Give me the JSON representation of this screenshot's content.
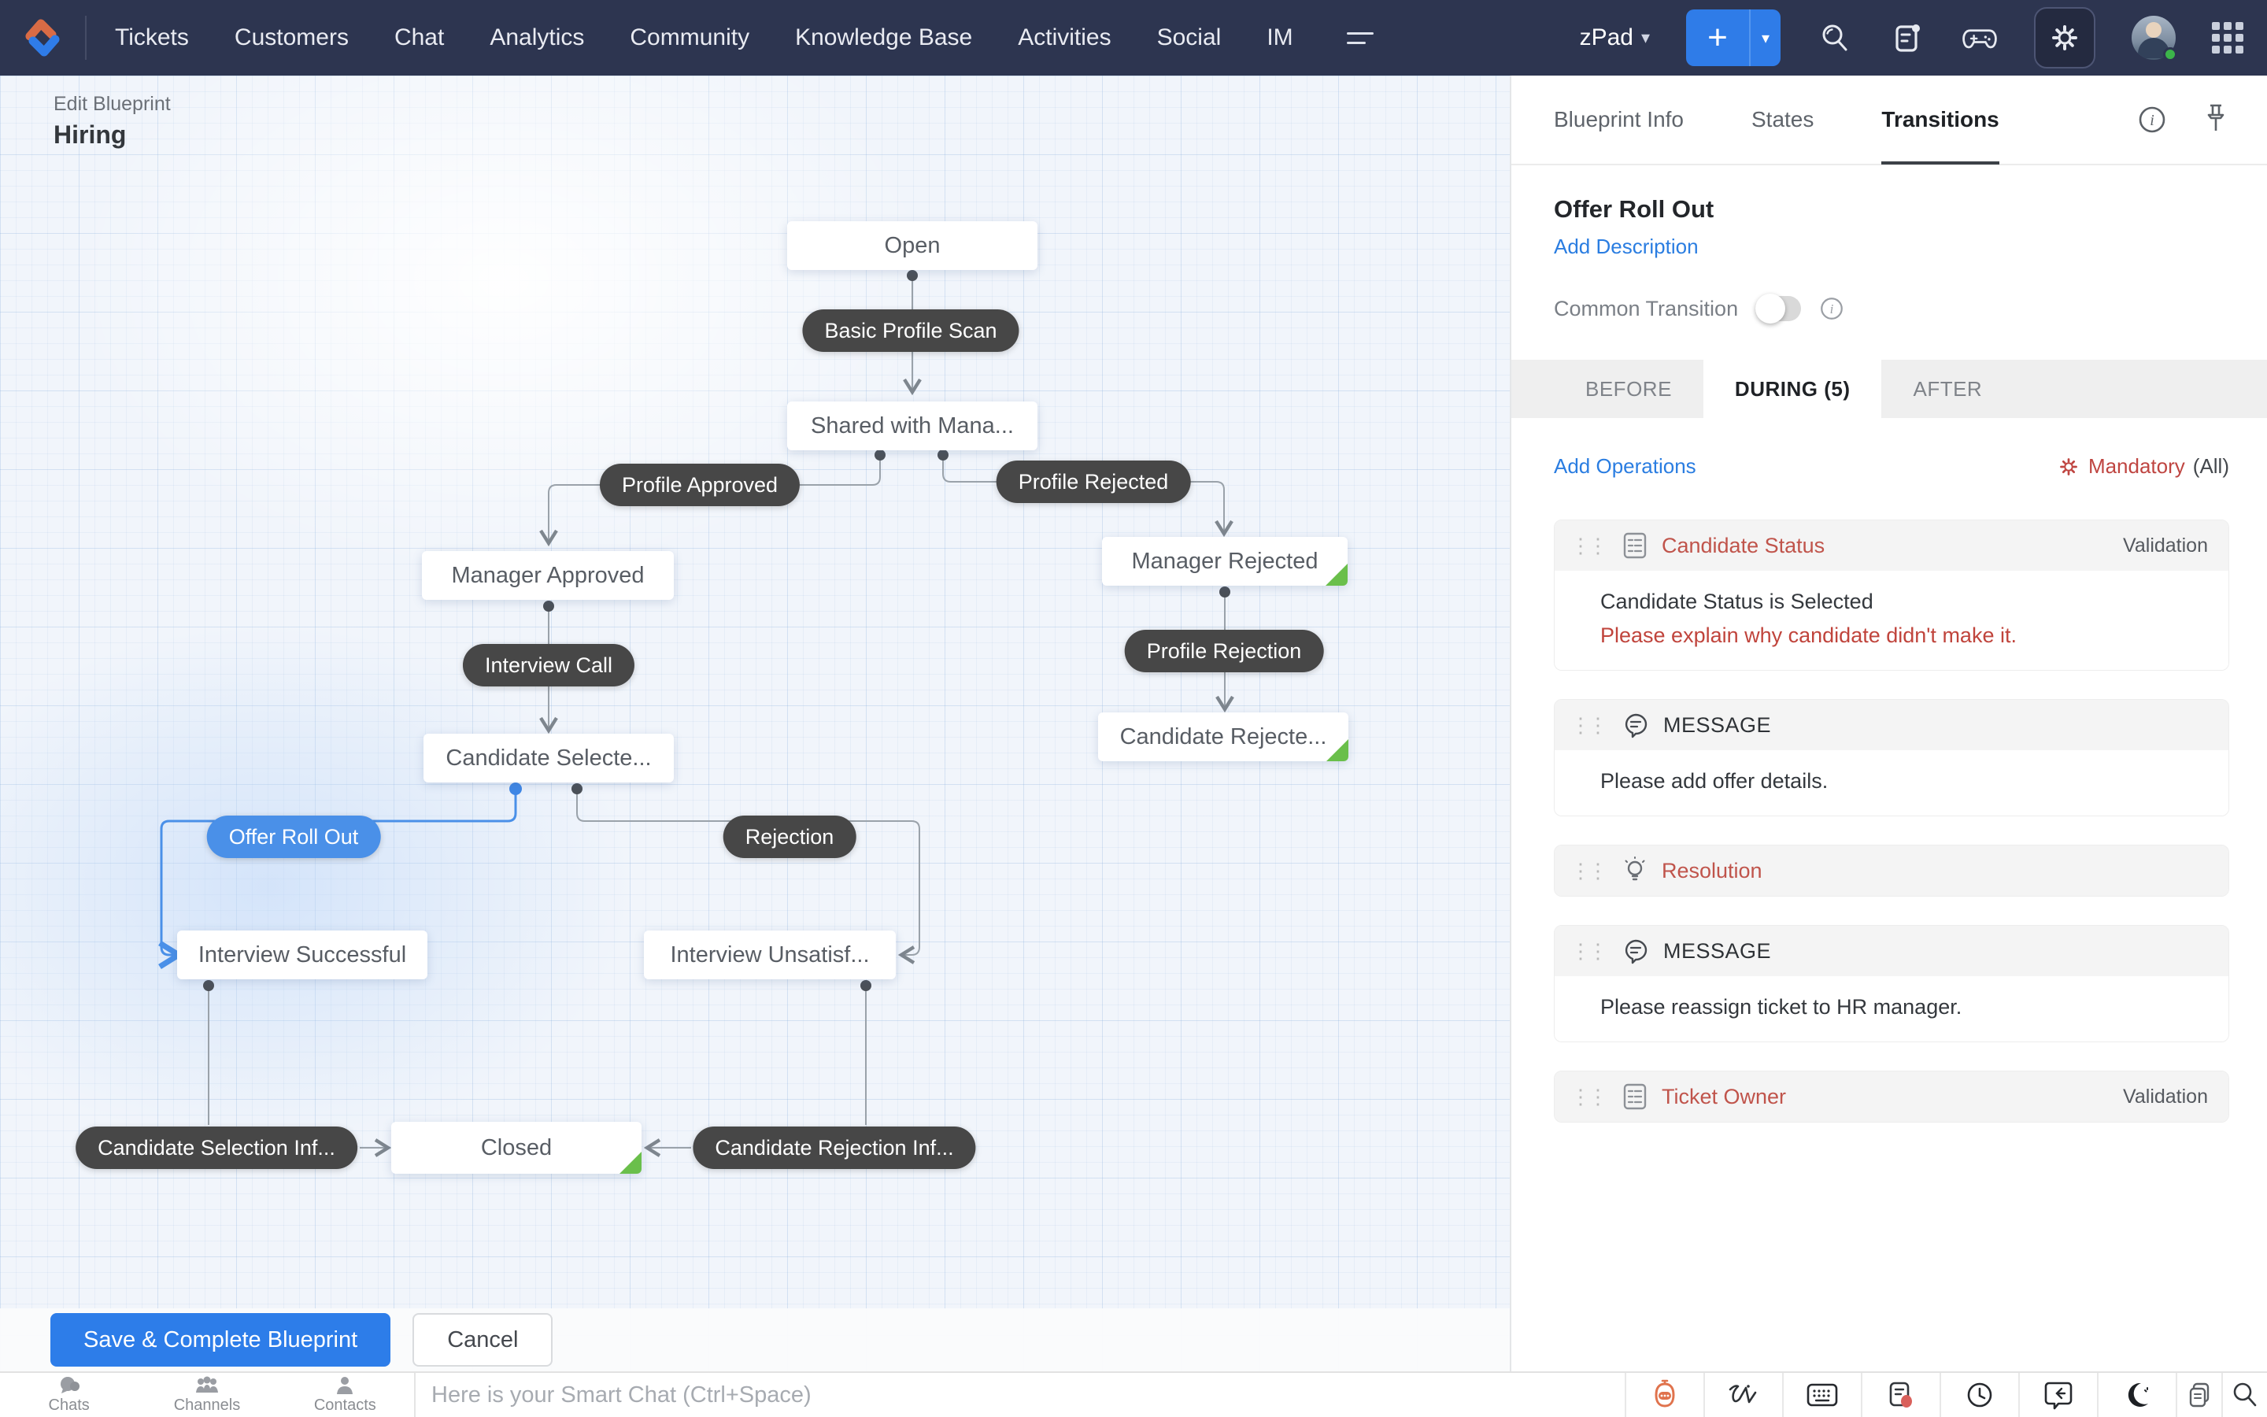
{
  "nav": {
    "items": [
      "Tickets",
      "Customers",
      "Chat",
      "Analytics",
      "Community",
      "Knowledge Base",
      "Activities",
      "Social",
      "IM"
    ],
    "workspace": "zPad",
    "add_label": "+",
    "caret": "▾"
  },
  "canvas": {
    "breadcrumb": "Edit Blueprint",
    "title": "Hiring",
    "nodes": {
      "open": "Open",
      "shared": "Shared with Mana...",
      "manager_approved": "Manager Approved",
      "manager_rejected": "Manager Rejected",
      "candidate_selected": "Candidate Selecte...",
      "candidate_rejected": "Candidate Rejecte...",
      "interview_successful": "Interview Successful",
      "interview_unsatisfactory": "Interview Unsatisf...",
      "closed": "Closed"
    },
    "transitions": {
      "basic_profile_scan": "Basic Profile Scan",
      "profile_approved": "Profile Approved",
      "profile_rejected": "Profile Rejected",
      "interview_call": "Interview Call",
      "profile_rejection": "Profile Rejection",
      "offer_roll_out": "Offer Roll Out",
      "rejection": "Rejection",
      "candidate_selection_inf": "Candidate Selection Inf...",
      "candidate_rejection_inf": "Candidate Rejection Inf..."
    }
  },
  "panel": {
    "tabs": [
      "Blueprint Info",
      "States",
      "Transitions"
    ],
    "title": "Offer Roll Out",
    "add_description": "Add Description",
    "common_transition_label": "Common Transition",
    "subtabs": [
      "BEFORE",
      "DURING (5)",
      "AFTER"
    ],
    "add_operations": "Add Operations",
    "mandatory_label": "Mandatory",
    "mandatory_scope": "(All)",
    "operations": [
      {
        "title": "Candidate Status",
        "type": "Validation",
        "line1": "Candidate Status is Selected",
        "line2": "Please explain why candidate didn't make it."
      },
      {
        "title": "MESSAGE",
        "line1": "Please add offer details."
      },
      {
        "title": "Resolution"
      },
      {
        "title": "MESSAGE",
        "line1": "Please reassign ticket to HR manager."
      },
      {
        "title": "Ticket Owner",
        "type": "Validation"
      }
    ]
  },
  "footer": {
    "save": "Save & Complete Blueprint",
    "cancel": "Cancel"
  },
  "bottombar": {
    "chats": "Chats",
    "channels": "Channels",
    "contacts": "Contacts",
    "placeholder": "Here is your Smart Chat (Ctrl+Space)"
  },
  "colors": {
    "nav_bg": "#2d3550",
    "accent_blue": "#2f7ce8",
    "selected_blue": "#4a90e8",
    "pill_dark": "#474747",
    "link_blue": "#2a7de1",
    "danger_red": "#c0544b",
    "green_flag": "#6abf4b"
  }
}
